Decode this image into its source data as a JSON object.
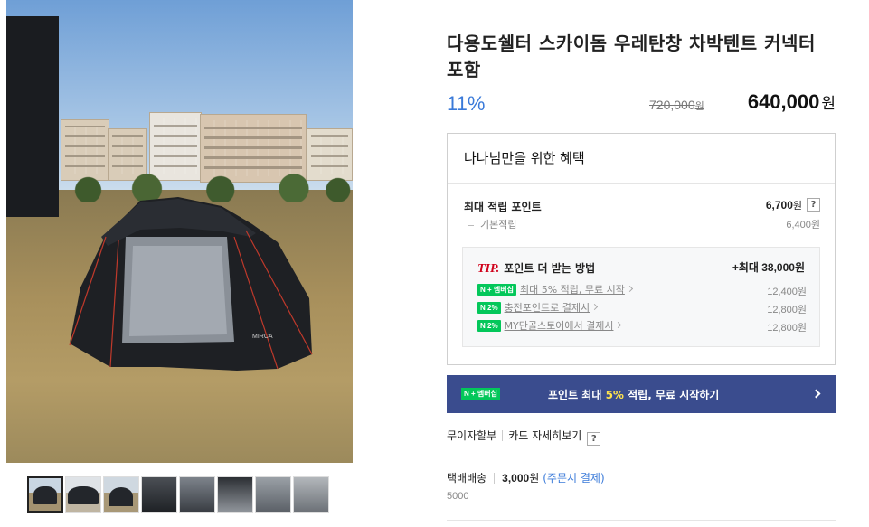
{
  "product": {
    "title": "다용도쉘터 스카이돔 우레탄창 차박텐트 커넥터 포함",
    "discount": "11%",
    "original_price": "720,000",
    "original_unit": "원",
    "sale_price": "640,000",
    "sale_unit": "원"
  },
  "gallery": {
    "main_image": "tent-photo",
    "tent_brand_mark": "MIRCA",
    "thumbnail_count": 8,
    "active_thumbnail": 1
  },
  "benefits": {
    "heading": "나나님만을 위한 혜택",
    "max_points_label": "최대 적립 포인트",
    "max_points_value": "6,700",
    "max_points_unit": "원",
    "base_label": "기본적립",
    "base_value": "6,400원",
    "help_mark": "?",
    "tip": {
      "mark": "TIP.",
      "title": "포인트 더 받는 방법",
      "total": "+최대 38,000원",
      "rows": [
        {
          "badge": "N + 멤버십",
          "label": "최대 5% 적립, 무료 시작",
          "amount": "12,400원"
        },
        {
          "badge": "N 2%",
          "label": "충전포인트로 결제시",
          "amount": "12,800원"
        },
        {
          "badge": "N 2%",
          "label": "MY단골스토어에서 결제시",
          "amount": "12,800원"
        }
      ]
    }
  },
  "cta": {
    "badge": "N + 멤버십",
    "text_prefix": "포인트 최대 ",
    "text_highlight": "5%",
    "text_suffix": " 적립, 무료 시작하기"
  },
  "payment": {
    "installment": "무이자할부",
    "card_detail": "카드 자세히보기",
    "help_mark": "?"
  },
  "shipping": {
    "label": "택배배송",
    "fee": "3,000",
    "fee_unit": "원",
    "condition": "(주문시 결제)",
    "extra": "5000"
  },
  "colors": {
    "accent_blue": "#3a7ad9",
    "cta_bg": "#3a4c8e",
    "naver_green": "#03c75a",
    "tip_red": "#d0021b",
    "highlight_yellow": "#ffe34d"
  }
}
